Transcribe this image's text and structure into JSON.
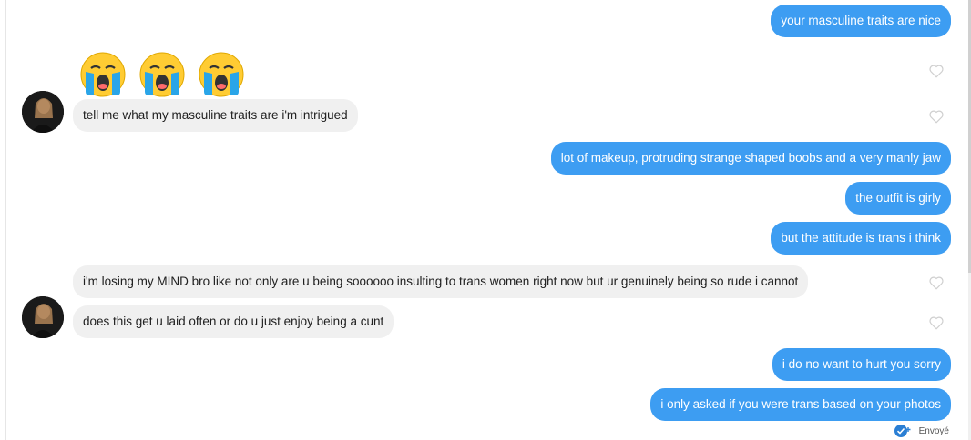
{
  "colors": {
    "outgoing": "#3d9df2",
    "incoming": "#f0f0f0",
    "check": "#2b7fd4"
  },
  "messages": [
    {
      "dir": "out",
      "text": "your masculine traits are nice"
    },
    {
      "dir": "in",
      "emoji": [
        "loudly-crying-face",
        "loudly-crying-face",
        "loudly-crying-face"
      ]
    },
    {
      "dir": "in",
      "text": "tell me what my masculine traits are i'm intrigued"
    },
    {
      "dir": "out",
      "text": "lot of makeup, protruding strange shaped boobs and a very manly jaw"
    },
    {
      "dir": "out",
      "text": "the outfit is girly"
    },
    {
      "dir": "out",
      "text": "but the attitude is trans i think"
    },
    {
      "dir": "in",
      "text": "i'm losing my MIND bro like not only are u being soooooo insulting to trans women right now but ur genuinely being so rude i cannot"
    },
    {
      "dir": "in",
      "text": "does this get u laid often or do u just enjoy being a cunt"
    },
    {
      "dir": "out",
      "text": "i do no want to hurt you sorry"
    },
    {
      "dir": "out",
      "text": "i only asked if you were trans based on your photos"
    }
  ],
  "status": {
    "label": "Envoyé"
  },
  "icons": {
    "like": "heart-icon",
    "seen": "check-circle-icon",
    "avatar": "avatar"
  }
}
